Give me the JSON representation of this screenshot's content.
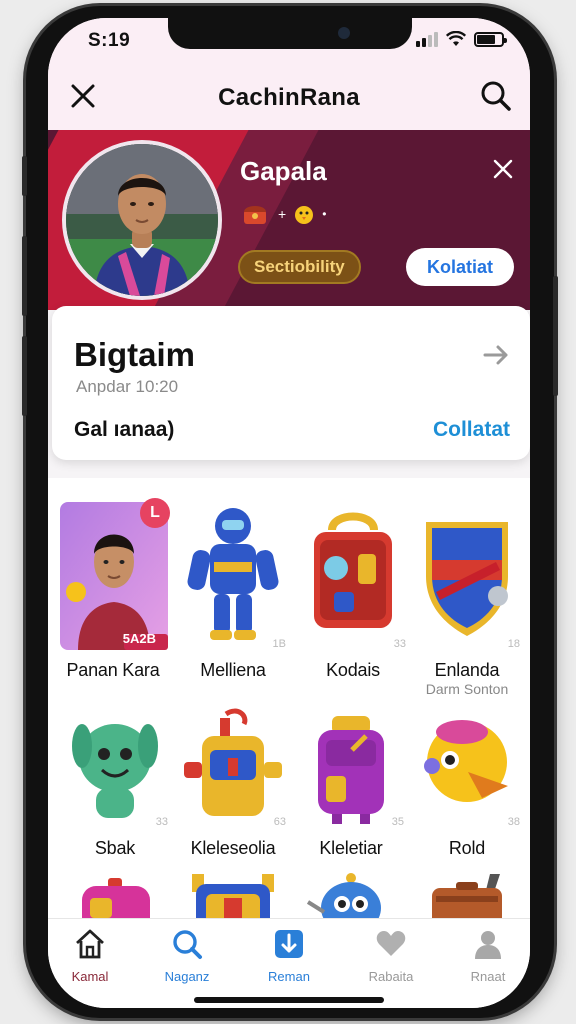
{
  "status": {
    "time": "S:19"
  },
  "header": {
    "title": "CachinRana"
  },
  "hero": {
    "name": "Gapala",
    "chip_label": "Sectiobility",
    "collect_label": "Kolatiat"
  },
  "card": {
    "heading": "Bigtaim",
    "subtitle": "Anpdar 10:20",
    "label": "Gal ıanaa)",
    "link": "Collatat"
  },
  "grid": {
    "items": [
      {
        "label": "Panan Kara",
        "badge": "5A2B",
        "corner": "L"
      },
      {
        "label": "Melliena",
        "badge": "1B"
      },
      {
        "label": "Kodais",
        "badge": "33"
      },
      {
        "label": "Enlanda",
        "sublabel": "Darm Sonton",
        "badge": "18"
      },
      {
        "label": "Sbak",
        "badge": "33"
      },
      {
        "label": "Kleleseolia",
        "badge": "63"
      },
      {
        "label": "Kleletiar",
        "badge": "35"
      },
      {
        "label": "Rold",
        "badge": "38"
      }
    ]
  },
  "tabs": [
    {
      "label": "Kamal",
      "icon": "home-icon"
    },
    {
      "label": "Naganz",
      "icon": "search-icon",
      "active": true
    },
    {
      "label": "Reman",
      "icon": "download-icon",
      "active": true
    },
    {
      "label": "Rabaita",
      "icon": "heart-icon"
    },
    {
      "label": "Rnaat",
      "icon": "profile-icon"
    }
  ],
  "colors": {
    "hero_bg": "#5b1734",
    "accent": "#2a7fd8",
    "chip_bg": "#7c5116"
  }
}
